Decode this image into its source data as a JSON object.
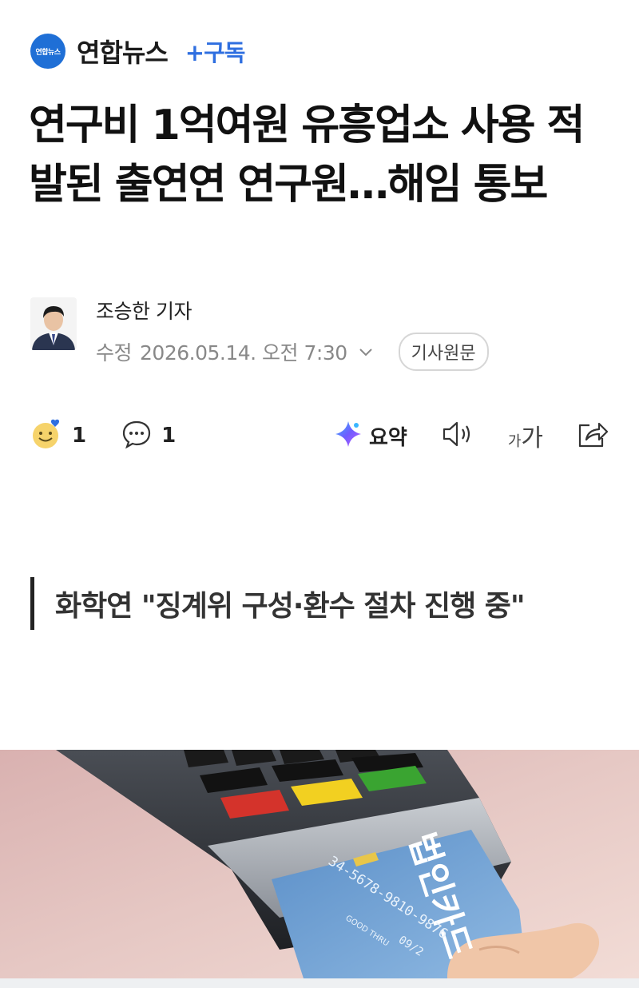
{
  "press": {
    "logo_text": "연합뉴스",
    "name": "연합뉴스",
    "subscribe_label": "+구독",
    "brand_color": "#1f6fd6",
    "accent_color": "#2f6fe0"
  },
  "article": {
    "headline": "연구비 1억여원 유흥업소 사용 적발된 출연연 연구원…해임 통보",
    "subhead": "화학연 \"징계위 구성·환수 절차 진행 중\""
  },
  "byline": {
    "reporter": "조승한 기자",
    "edited_label": "수정",
    "edited_date": "2026.05.14. 오전 7:30",
    "original_article_label": "기사원문"
  },
  "actions": {
    "reaction_count": "1",
    "comment_count": "1",
    "summary_label": "요약",
    "icons": [
      "smile-reaction-icon",
      "comment-icon",
      "ai-summary-icon",
      "speaker-icon",
      "font-size-icon",
      "share-icon"
    ],
    "font_size_small": "가",
    "font_size_big": "가"
  },
  "photo": {
    "card_text": "법인카드",
    "card_number": "34-5678-9810-9876",
    "card_good_thru_label": "GOOD THRU",
    "card_expiry": "09/2"
  }
}
